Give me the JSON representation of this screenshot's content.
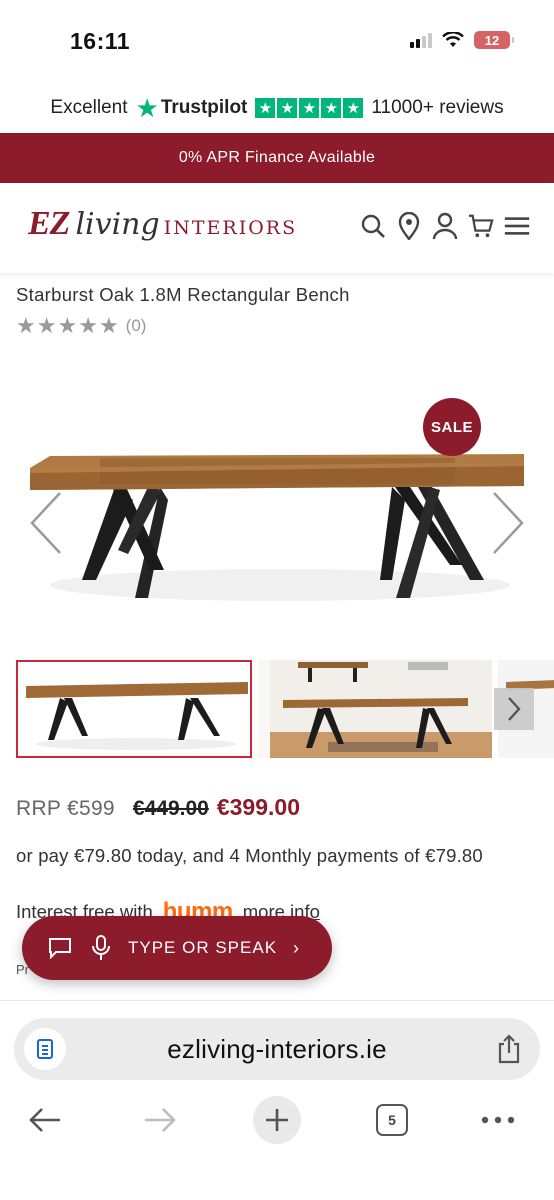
{
  "status": {
    "time": "16:11",
    "battery": "12"
  },
  "trust": {
    "label": "Excellent",
    "brand": "Trustpilot",
    "reviews": "11000+ reviews"
  },
  "banner": {
    "text": "0% APR Finance Available"
  },
  "logo": {
    "ez": "EZ",
    "living": "living",
    "interiors": "INTERIORS"
  },
  "header": {
    "icons": [
      "search-icon",
      "location-pin-icon",
      "account-icon",
      "cart-icon",
      "menu-icon"
    ]
  },
  "product": {
    "title": "Starburst Oak 1.8M Rectangular Bench",
    "rating_count": "(0)",
    "sale_badge": "SALE",
    "rrp": "RRP €599",
    "was_price": "€449.00",
    "now_price": "€399.00",
    "pay_text": "or pay €79.80 today, and 4 Monthly payments of €79.80",
    "interest_text": "Interest free with",
    "humm_logo": "humm",
    "more_info": "more info",
    "partial_text": "Pr"
  },
  "assistant": {
    "label": "TYPE OR SPEAK",
    "chevron": "›"
  },
  "browser": {
    "url": "ezliving-interiors.ie",
    "tab_count": "5"
  },
  "colors": {
    "brand": "#8c1c2b",
    "trustpilot": "#00b67a",
    "humm": "#ff6b13"
  }
}
